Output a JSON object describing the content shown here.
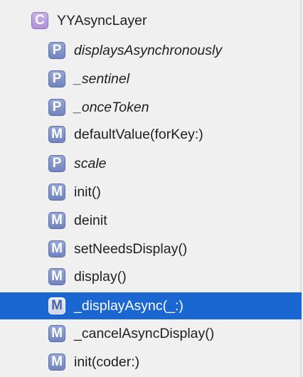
{
  "tree": {
    "root": {
      "badge": "C",
      "label": "YYAsyncLayer"
    },
    "items": [
      {
        "badge": "P",
        "label": "displaysAsynchronously",
        "italic": true
      },
      {
        "badge": "P",
        "label": "_sentinel",
        "italic": true
      },
      {
        "badge": "P",
        "label": "_onceToken",
        "italic": true
      },
      {
        "badge": "M",
        "label": "defaultValue(forKey:)",
        "italic": false
      },
      {
        "badge": "P",
        "label": "scale",
        "italic": true
      },
      {
        "badge": "M",
        "label": "init()",
        "italic": false
      },
      {
        "badge": "M",
        "label": "deinit",
        "italic": false
      },
      {
        "badge": "M",
        "label": "setNeedsDisplay()",
        "italic": false
      },
      {
        "badge": "M",
        "label": "display()",
        "italic": false
      },
      {
        "badge": "M",
        "label": "_displayAsync(_:)",
        "italic": false,
        "selected": true
      },
      {
        "badge": "M",
        "label": "_cancelAsyncDisplay()",
        "italic": false
      },
      {
        "badge": "M",
        "label": "init(coder:)",
        "italic": false
      }
    ]
  },
  "colors": {
    "selection": "#1a67d2",
    "class_badge": "#ad92d9",
    "member_badge": "#7084bf"
  },
  "icons": {
    "class": "class-icon",
    "property": "property-icon",
    "method": "method-icon"
  }
}
